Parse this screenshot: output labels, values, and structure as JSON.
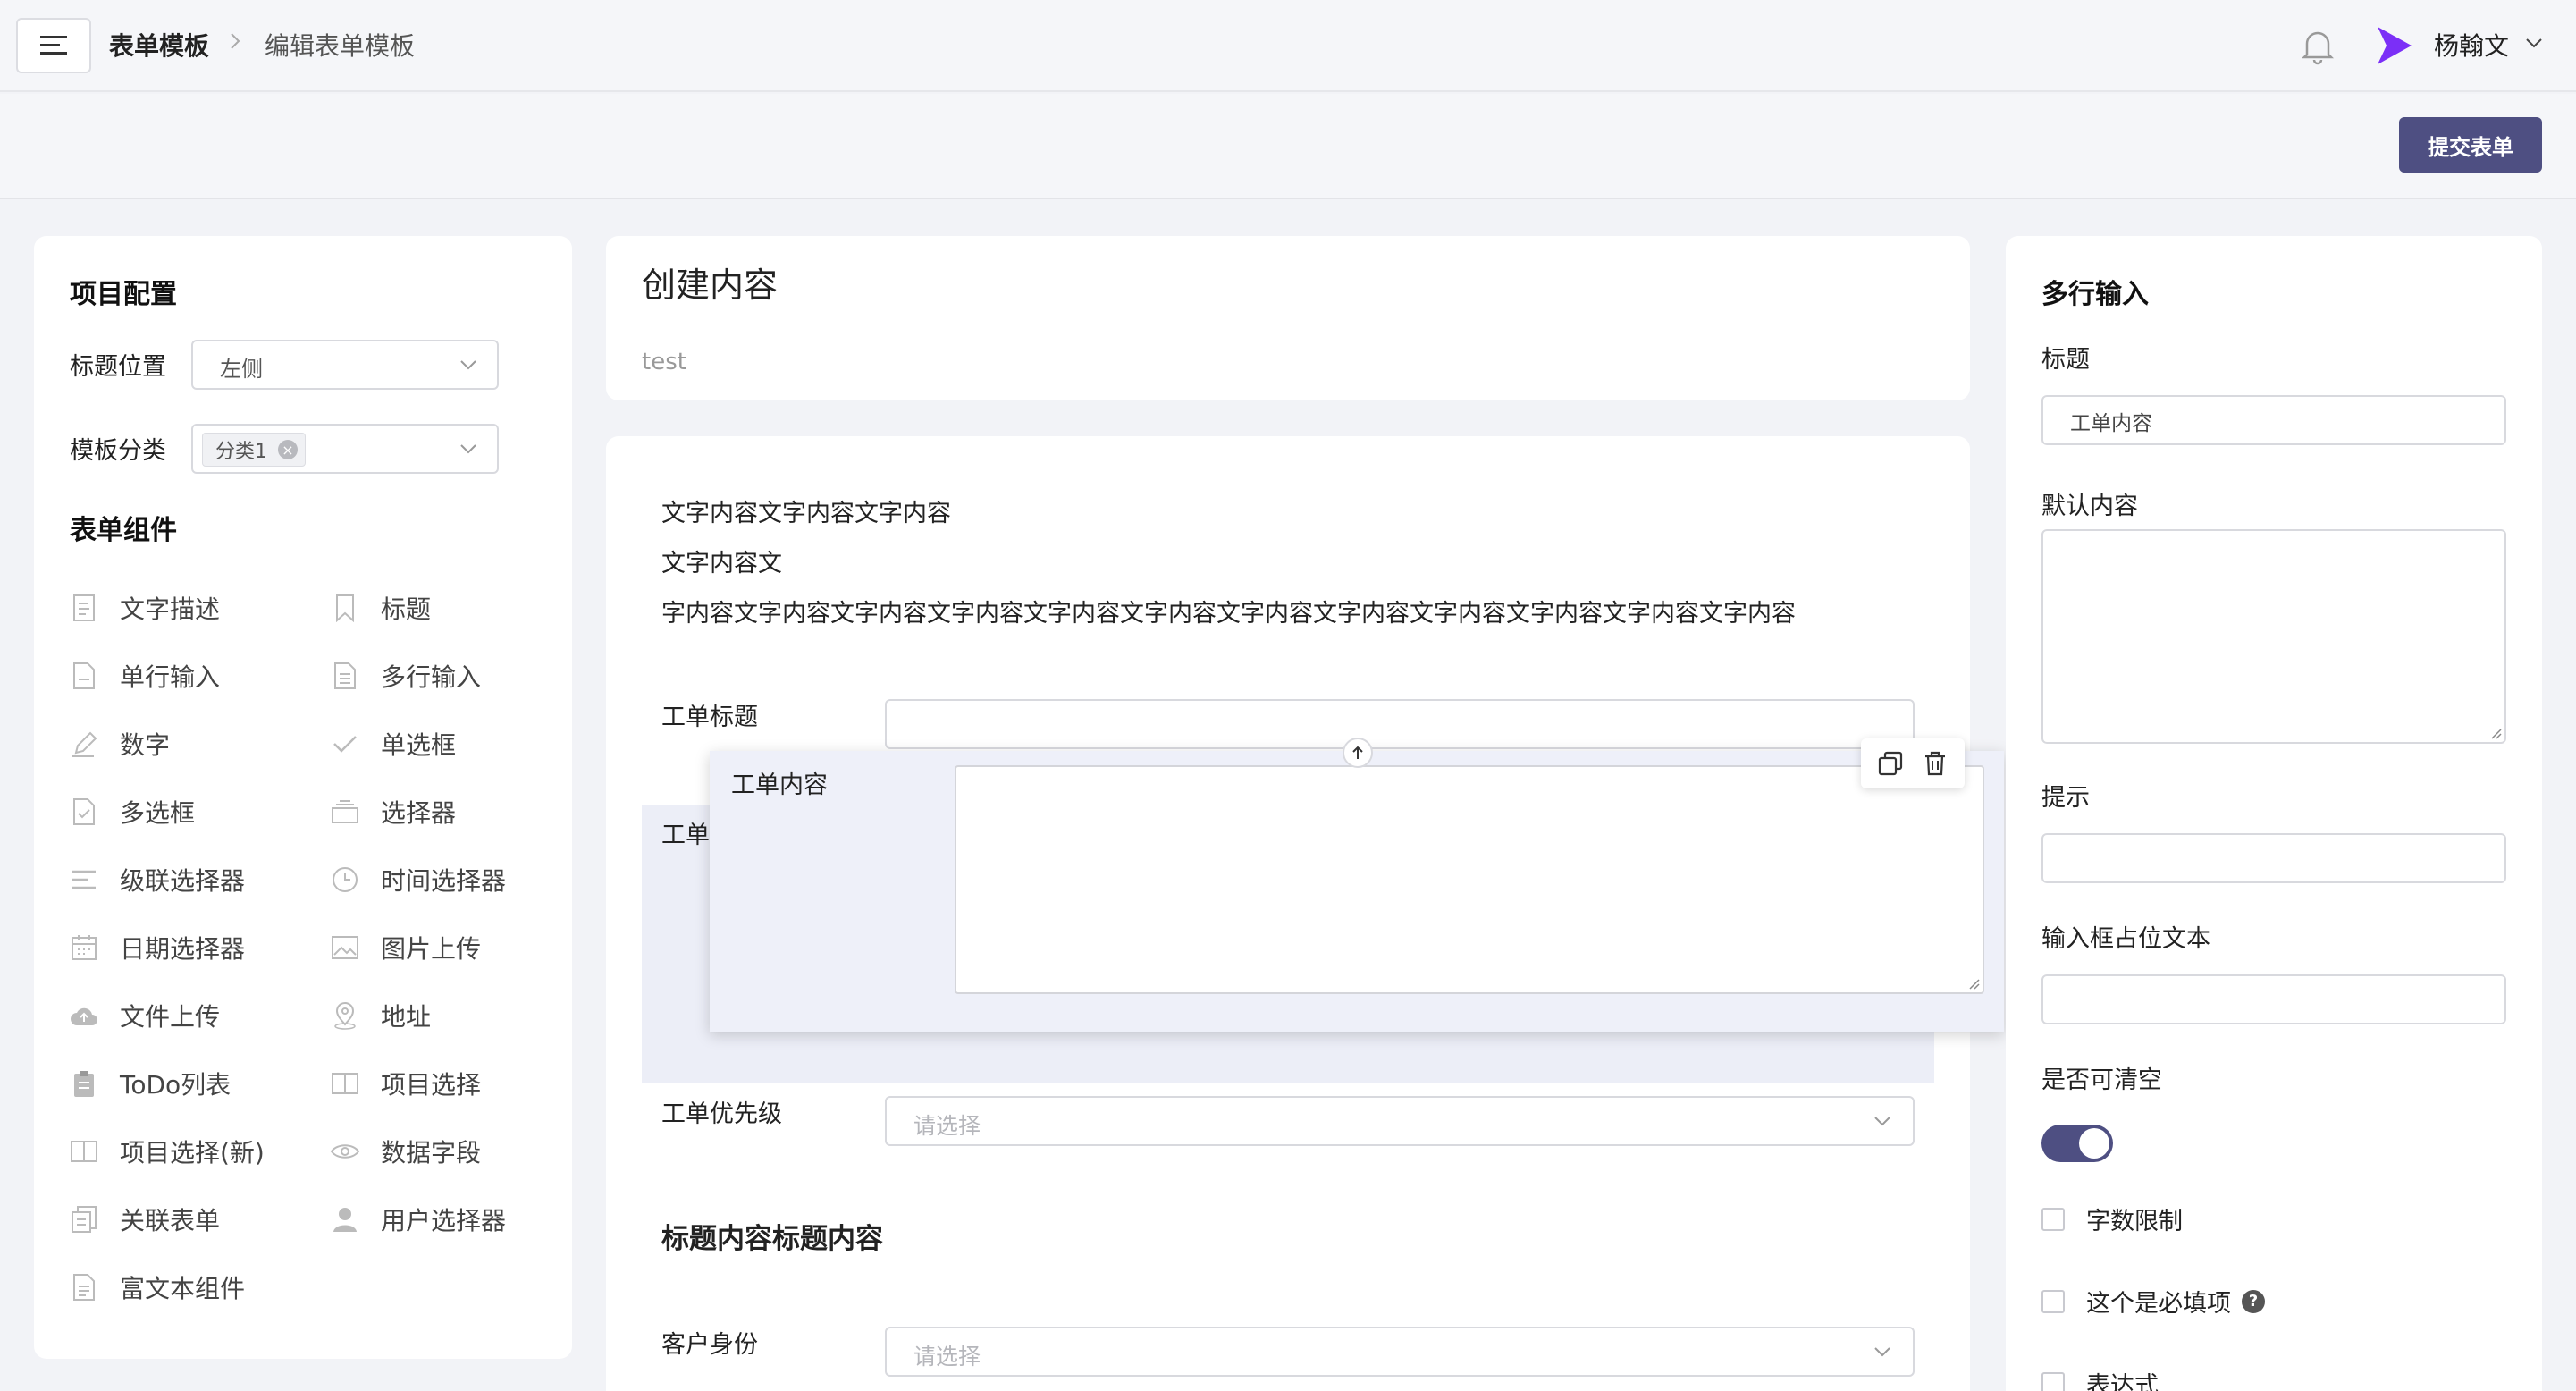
{
  "header": {
    "breadcrumb_root": "表单模板",
    "breadcrumb_current": "编辑表单模板",
    "username": "杨翰文"
  },
  "actions": {
    "submit_label": "提交表单"
  },
  "left_panel": {
    "project_config_title": "项目配置",
    "title_position_label": "标题位置",
    "title_position_value": "左侧",
    "template_category_label": "模板分类",
    "template_category_tag": "分类1",
    "components_title": "表单组件",
    "components": [
      {
        "label": "文字描述",
        "icon": "text-description-icon"
      },
      {
        "label": "标题",
        "icon": "bookmark-icon"
      },
      {
        "label": "单行输入",
        "icon": "document-icon"
      },
      {
        "label": "多行输入",
        "icon": "document-lines-icon"
      },
      {
        "label": "数字",
        "icon": "pen-icon"
      },
      {
        "label": "单选框",
        "icon": "check-icon"
      },
      {
        "label": "多选框",
        "icon": "checkbox-document-icon"
      },
      {
        "label": "选择器",
        "icon": "tray-icon"
      },
      {
        "label": "级联选择器",
        "icon": "list-icon"
      },
      {
        "label": "时间选择器",
        "icon": "clock-icon"
      },
      {
        "label": "日期选择器",
        "icon": "calendar-icon"
      },
      {
        "label": "图片上传",
        "icon": "image-icon"
      },
      {
        "label": "文件上传",
        "icon": "cloud-upload-icon"
      },
      {
        "label": "地址",
        "icon": "location-icon"
      },
      {
        "label": "ToDo列表",
        "icon": "clipboard-icon"
      },
      {
        "label": "项目选择",
        "icon": "book-icon"
      },
      {
        "label": "项目选择(新)",
        "icon": "book-icon"
      },
      {
        "label": "数据字段",
        "icon": "eye-icon"
      },
      {
        "label": "关联表单",
        "icon": "linked-document-icon"
      },
      {
        "label": "用户选择器",
        "icon": "user-icon"
      },
      {
        "label": "富文本组件",
        "icon": "rich-text-icon"
      }
    ]
  },
  "form": {
    "title": "创建内容",
    "subtitle": "test",
    "text_lines": [
      "文字内容文字内容文字内容",
      "文字内容文",
      "字内容文字内容文字内容文字内容文字内容文字内容文字内容文字内容文字内容文字内容文字内容文字内容"
    ],
    "ticket_title_label": "工单标题",
    "ticket_content_label": "工单内容",
    "ghost_label_prefix": "工单",
    "ghost_label_suffix": "内容",
    "priority_label": "工单优先级",
    "priority_placeholder": "请选择",
    "section_heading": "标题内容标题内容",
    "customer_label": "客户身份",
    "customer_placeholder": "请选择"
  },
  "properties": {
    "panel_title": "多行输入",
    "title_label": "标题",
    "title_value": "工单内容",
    "default_label": "默认内容",
    "default_value": "",
    "hint_label": "提示",
    "hint_value": "",
    "placeholder_label": "输入框占位文本",
    "placeholder_value": "",
    "clearable_label": "是否可清空",
    "clearable_on": true,
    "char_limit_label": "字数限制",
    "required_label": "这个是必填项",
    "expression_label": "表达式"
  },
  "colors": {
    "accent": "#4e4f82",
    "logo": "#7b2ff7"
  }
}
